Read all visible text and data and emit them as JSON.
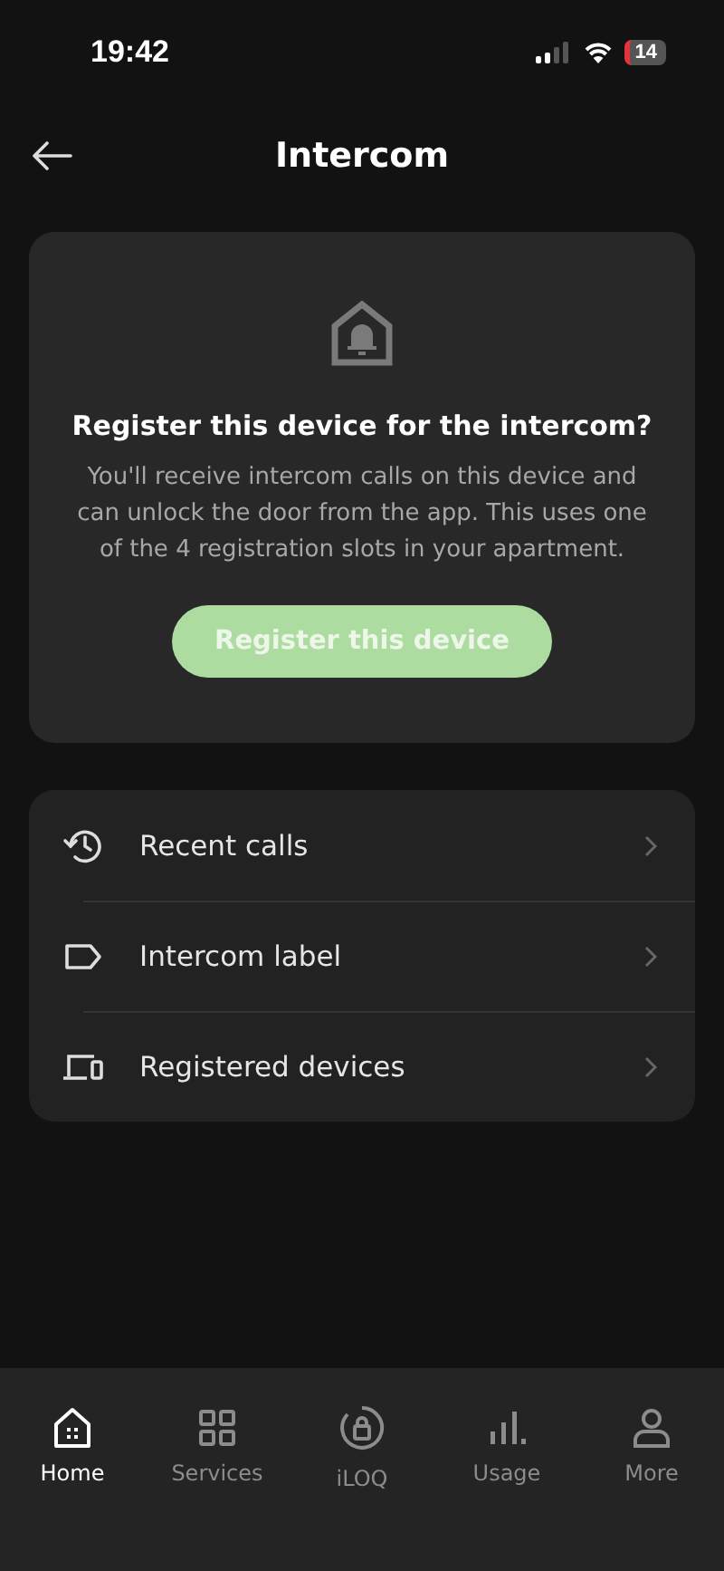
{
  "status_bar": {
    "time": "19:42",
    "battery": "14"
  },
  "header": {
    "title": "Intercom"
  },
  "register_card": {
    "title": "Register this device for the intercom?",
    "body": "You'll receive intercom calls on this device and can unlock the door from the app. This uses one of the 4 registration slots in your apartment.",
    "button": "Register this device"
  },
  "menu": [
    {
      "kind": "history",
      "label": "Recent calls"
    },
    {
      "kind": "label",
      "label": "Intercom label"
    },
    {
      "kind": "devices",
      "label": "Registered devices"
    }
  ],
  "tab_bar": [
    {
      "kind": "home",
      "label": "Home",
      "selected": true
    },
    {
      "kind": "grid",
      "label": "Services",
      "selected": false
    },
    {
      "kind": "lock",
      "label": "iLOQ",
      "selected": false
    },
    {
      "kind": "bars",
      "label": "Usage",
      "selected": false
    },
    {
      "kind": "person",
      "label": "More",
      "selected": false
    }
  ]
}
